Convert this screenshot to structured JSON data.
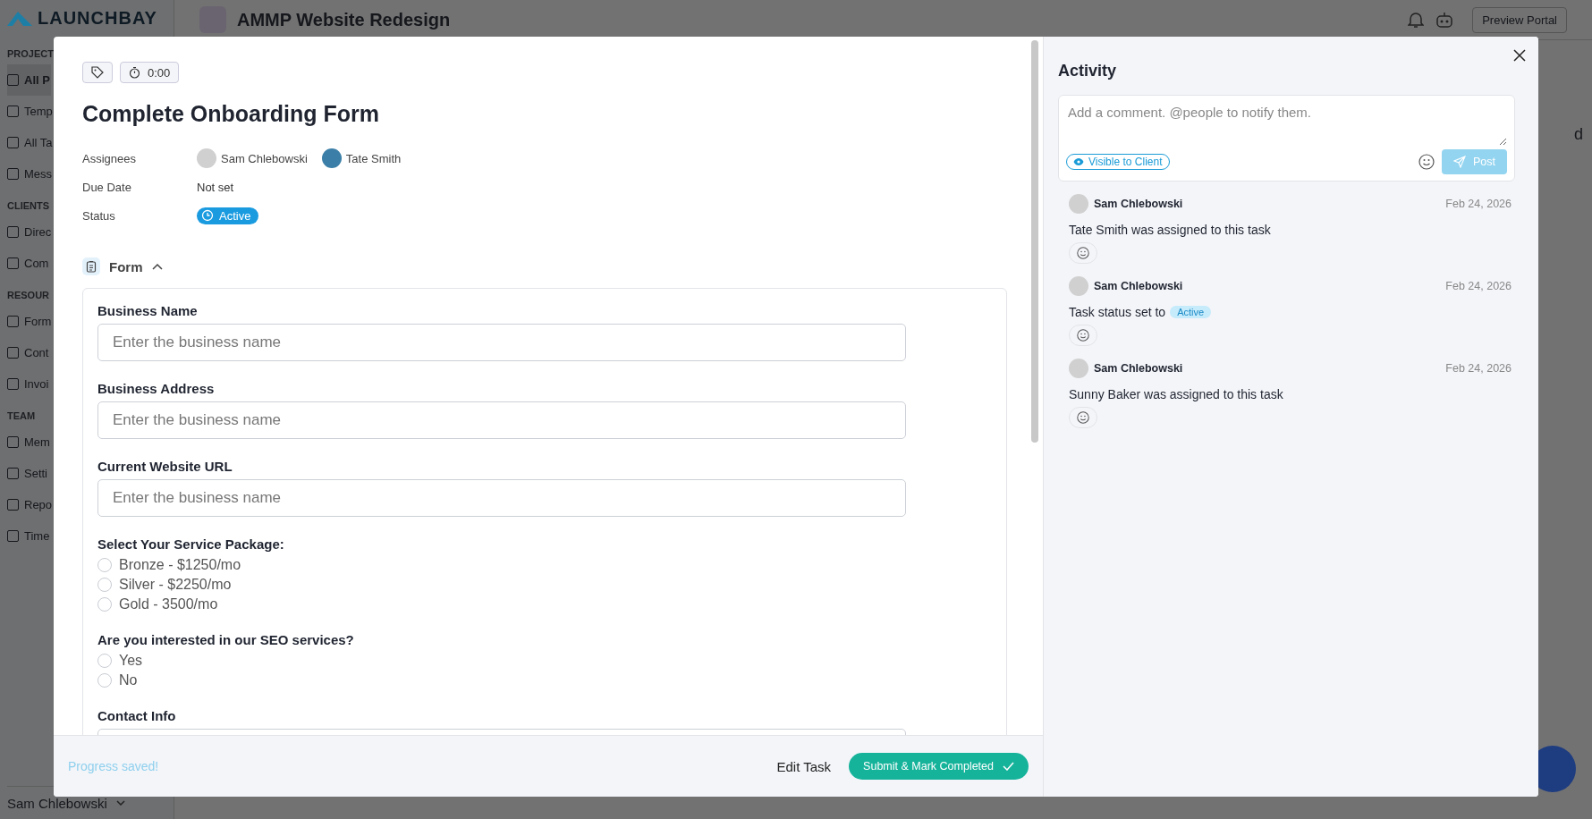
{
  "app": {
    "logo": "LAUNCHBAY",
    "project_title": "AMMP Website Redesign",
    "preview_button": "Preview Portal",
    "user": "Sam Chlebowski",
    "fragment": "d",
    "sidebar": [
      {
        "heading": "PROJECT",
        "items": [
          {
            "label": "All P",
            "selected": true
          },
          {
            "label": "Temp",
            "selected": false
          },
          {
            "label": "All Ta",
            "selected": false
          },
          {
            "label": "Mess",
            "selected": false
          }
        ]
      },
      {
        "heading": "CLIENTS",
        "items": [
          {
            "label": "Direc",
            "selected": false
          },
          {
            "label": "Com",
            "selected": false
          }
        ]
      },
      {
        "heading": "RESOUR",
        "items": [
          {
            "label": "Form",
            "selected": false
          },
          {
            "label": "Cont",
            "selected": false
          },
          {
            "label": "Invoi",
            "selected": false
          }
        ]
      },
      {
        "heading": "TEAM",
        "items": [
          {
            "label": "Mem",
            "selected": false
          },
          {
            "label": "Setti",
            "selected": false
          },
          {
            "label": "Repo",
            "selected": false
          },
          {
            "label": "Time",
            "selected": false
          }
        ]
      }
    ]
  },
  "task": {
    "timer": "0:00",
    "title": "Complete Onboarding Form",
    "properties": [
      {
        "kind": "people",
        "label": "Assignees",
        "people": [
          "Sam Chlebowski",
          "Tate Smith"
        ]
      },
      {
        "kind": "text",
        "label": "Due Date",
        "value": "Not set"
      },
      {
        "kind": "status",
        "label": "Status",
        "value": "Active"
      }
    ],
    "form_section": {
      "title": "Form",
      "expanded": true
    },
    "fields": [
      {
        "kind": "text",
        "label": "Business Name",
        "placeholder": "Enter the business name"
      },
      {
        "kind": "text",
        "label": "Business Address",
        "placeholder": "Enter the business name"
      },
      {
        "kind": "text",
        "label": "Current Website URL",
        "placeholder": "Enter the business name"
      },
      {
        "kind": "radio",
        "label": "Select Your Service Package:",
        "options": [
          {
            "label": "Bronze - $1250/mo",
            "selected": false
          },
          {
            "label": "Silver - $2250/mo",
            "selected": false
          },
          {
            "label": "Gold - 3500/mo",
            "selected": false
          }
        ]
      },
      {
        "kind": "radio",
        "label": "Are you interested in our SEO services?",
        "options": [
          {
            "label": "Yes",
            "selected": false
          },
          {
            "label": "No",
            "selected": false
          }
        ]
      },
      {
        "kind": "text",
        "label": "Contact Info"
      }
    ],
    "footer": {
      "status": "Progress saved!",
      "edit_button": "Edit Task",
      "submit_button": "Submit & Mark Completed"
    }
  },
  "activity": {
    "title": "Activity",
    "comment_placeholder": "Add a comment. @people to notify them.",
    "visibility": "Visible to Client",
    "post_button": "Post",
    "entries": [
      {
        "author": "Sam Chlebowski",
        "date": "Feb 24, 2026",
        "text": "Tate Smith was assigned to this task"
      },
      {
        "author": "Sam Chlebowski",
        "date": "Feb 24, 2026",
        "text": "Task status set to",
        "badge": "Active"
      },
      {
        "author": "Sam Chlebowski",
        "date": "Feb 24, 2026",
        "text": "Sunny Baker was assigned to this task"
      }
    ]
  }
}
